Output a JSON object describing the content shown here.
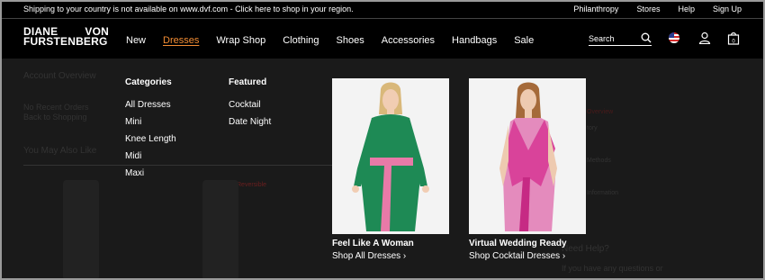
{
  "topbar": {
    "message": "Shipping to your country is not available on www.dvf.com - Click here to shop in your region.",
    "utility_links": [
      "Philanthropy",
      "Stores",
      "Help",
      "Sign Up"
    ]
  },
  "brand": {
    "line1_left": "DIANE",
    "line1_right": "VON",
    "line2": "FURSTENBERG"
  },
  "nav": {
    "items": [
      "New",
      "Dresses",
      "Wrap Shop",
      "Clothing",
      "Shoes",
      "Accessories",
      "Handbags",
      "Sale"
    ],
    "active_index": 1,
    "active_color": "#f28c33"
  },
  "search": {
    "label": "Search",
    "icon": "search-icon"
  },
  "header_icons": [
    "us-flag-icon",
    "user-icon",
    "shopping-bag-icon"
  ],
  "bag_count": "0",
  "background_page": {
    "account_overview": "Account Overview",
    "no_recent_orders": "No Recent Orders",
    "back_to_shopping": "Back to Shopping",
    "you_may_also_like": "You May Also Like",
    "reversible": "Reversible",
    "right_fragments": [
      "Overview",
      "tory",
      "Methods",
      "Information",
      "Need Help?",
      "If you have any questions or"
    ]
  },
  "mega_menu": {
    "categories_title": "Categories",
    "categories": [
      "All Dresses",
      "Mini",
      "Knee Length",
      "Midi",
      "Maxi"
    ],
    "featured_title": "Featured",
    "featured": [
      "Cocktail",
      "Date Night"
    ],
    "promos": [
      {
        "title": "Feel Like A Woman",
        "link": "Shop All Dresses ›",
        "dress_color": "#1e8a55",
        "sash_color": "#e87aa8"
      },
      {
        "title": "Virtual Wedding Ready",
        "link": "Shop Cocktail Dresses ›",
        "dress_color": "#d9439a",
        "sash_color": "#c62a84"
      }
    ]
  }
}
